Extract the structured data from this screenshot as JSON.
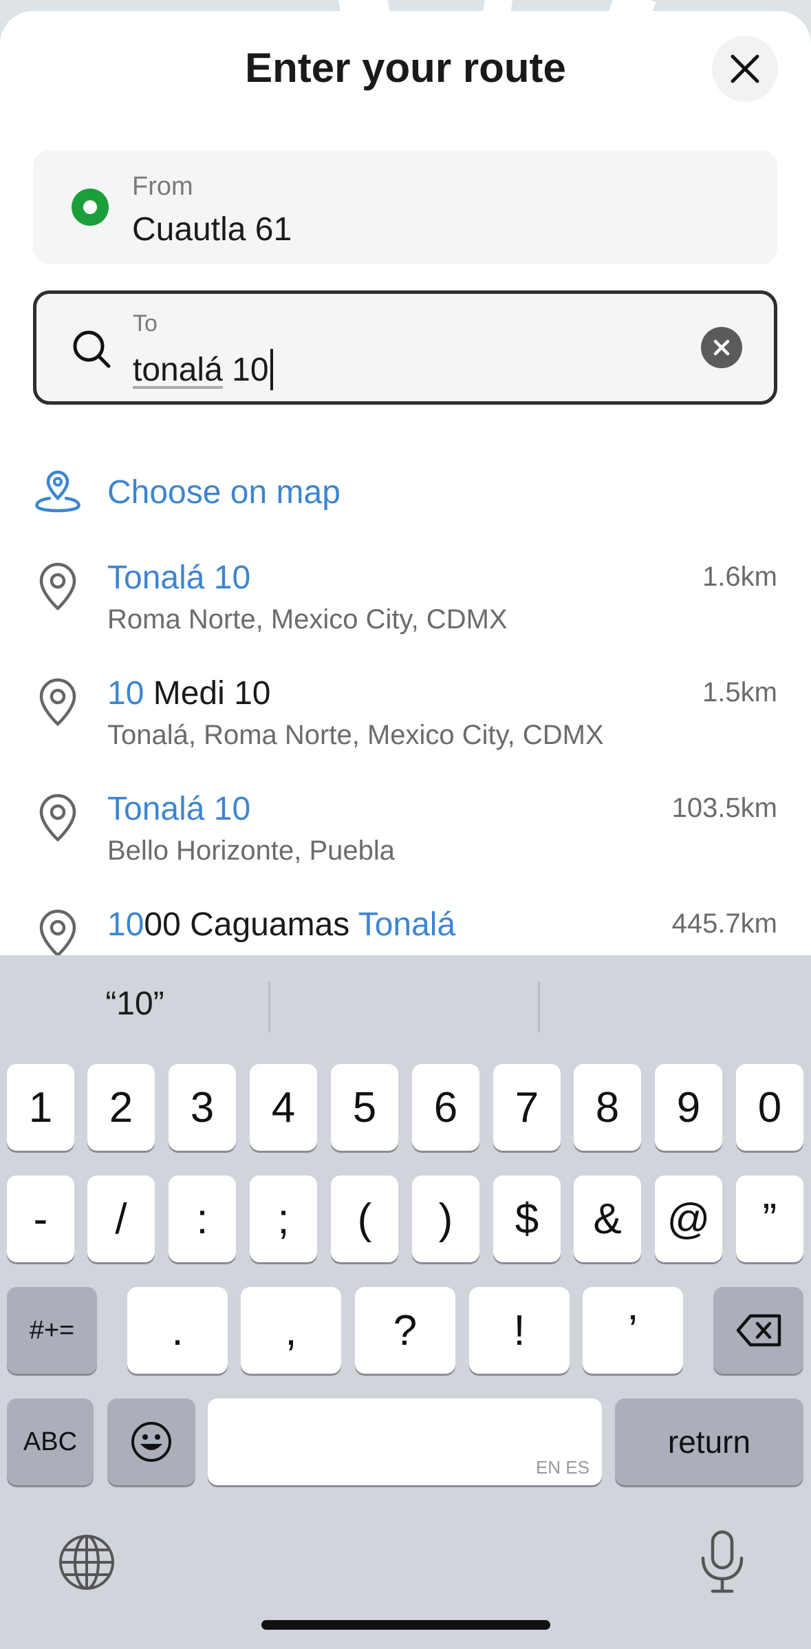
{
  "header": {
    "title": "Enter your route"
  },
  "from": {
    "label": "From",
    "value": "Cuautla 61"
  },
  "to": {
    "label": "To",
    "value_underlined": "tonalá",
    "value_rest": " 10"
  },
  "choose_on_map": {
    "label": "Choose on map"
  },
  "results": [
    {
      "name_parts": [
        {
          "text": "Tonalá 10",
          "hl": true
        }
      ],
      "address": "Roma Norte, Mexico City, CDMX",
      "distance": "1.6km"
    },
    {
      "name_parts": [
        {
          "text": "10",
          "hl": true
        },
        {
          "text": " Medi 10",
          "hl": false
        }
      ],
      "address": "Tonalá, Roma Norte, Mexico City, CDMX",
      "distance": "1.5km"
    },
    {
      "name_parts": [
        {
          "text": "Tonalá 10",
          "hl": true
        }
      ],
      "address": "Bello Horizonte, Puebla",
      "distance": "103.5km"
    },
    {
      "name_parts": [
        {
          "text": "10",
          "hl": true
        },
        {
          "text": "00 Caguamas ",
          "hl": false
        },
        {
          "text": "Tonalá",
          "hl": true
        }
      ],
      "address": "",
      "distance": "445.7km"
    }
  ],
  "keyboard": {
    "suggestion": "“10”",
    "row1": [
      "1",
      "2",
      "3",
      "4",
      "5",
      "6",
      "7",
      "8",
      "9",
      "0"
    ],
    "row2": [
      "-",
      "/",
      ":",
      ";",
      "(",
      ")",
      "$",
      "&",
      "@",
      "”"
    ],
    "row3": [
      ".",
      ",",
      "?",
      "!",
      "’"
    ],
    "symbols_key": "#+=",
    "abc_key": "ABC",
    "return_key": "return",
    "space_hint": "EN ES",
    "emoji_icon": "emoji-icon",
    "globe_icon": "globe-icon",
    "mic_icon": "microphone-icon",
    "backspace_icon": "backspace-icon"
  },
  "colors": {
    "accent": "#3d85d1",
    "from_dot": "#1b9f3a"
  }
}
